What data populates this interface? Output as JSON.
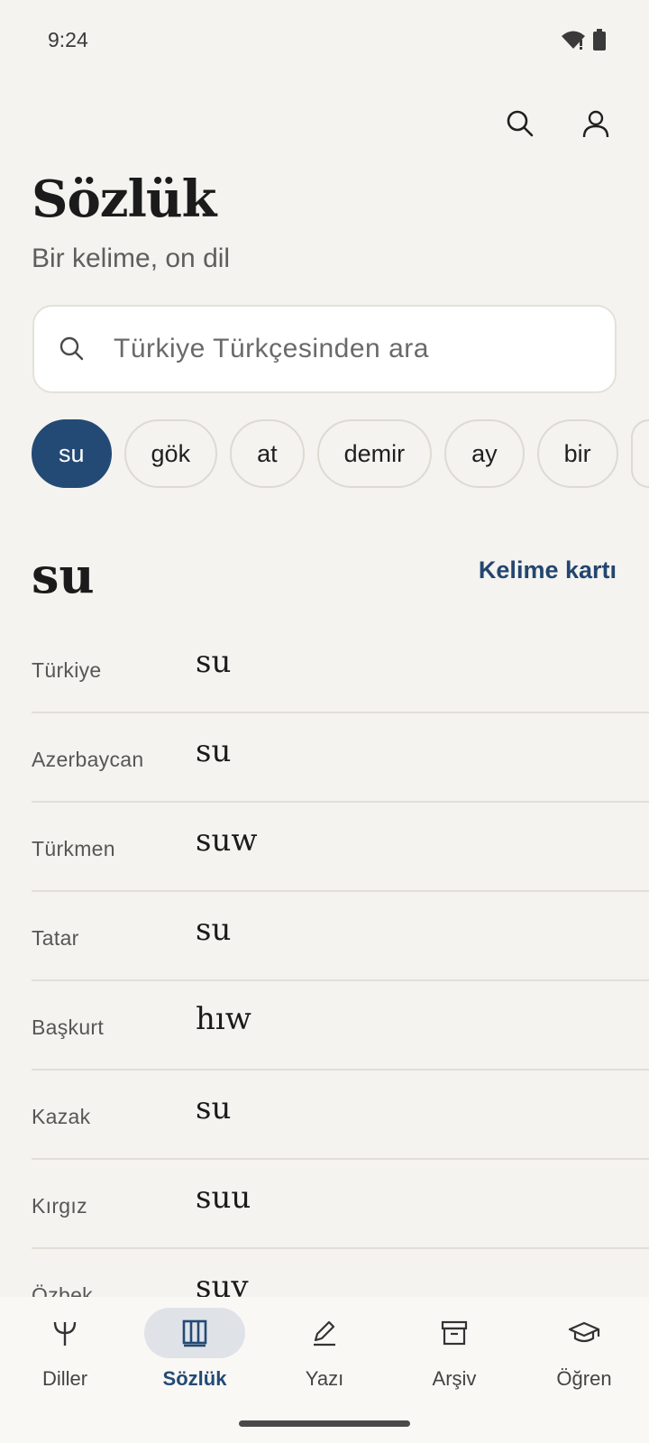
{
  "status": {
    "time": "9:24"
  },
  "header": {
    "title": "Sözlük",
    "subtitle": "Bir kelime, on dil"
  },
  "search": {
    "placeholder": "Türkiye Türkçesinden ara",
    "value": ""
  },
  "chips": [
    "su",
    "gök",
    "at",
    "demir",
    "ay",
    "bir"
  ],
  "active_chip": "su",
  "entry": {
    "word": "su",
    "card_link": "Kelime kartı",
    "rows": [
      {
        "lang": "Türkiye",
        "word": "su"
      },
      {
        "lang": "Azerbaycan",
        "word": "su"
      },
      {
        "lang": "Türkmen",
        "word": "suw"
      },
      {
        "lang": "Tatar",
        "word": "su"
      },
      {
        "lang": "Başkurt",
        "word": "hıw"
      },
      {
        "lang": "Kazak",
        "word": "su"
      },
      {
        "lang": "Kırgız",
        "word": "suu"
      },
      {
        "lang": "Özbek",
        "word": "suv"
      }
    ]
  },
  "nav": [
    {
      "label": "Diller",
      "icon": "trident-icon"
    },
    {
      "label": "Sözlük",
      "icon": "book-icon",
      "active": true
    },
    {
      "label": "Yazı",
      "icon": "pen-icon"
    },
    {
      "label": "Arşiv",
      "icon": "archive-icon"
    },
    {
      "label": "Öğren",
      "icon": "graduation-cap-icon"
    }
  ],
  "colors": {
    "accent": "#234a75",
    "background": "#f4f3ef"
  }
}
